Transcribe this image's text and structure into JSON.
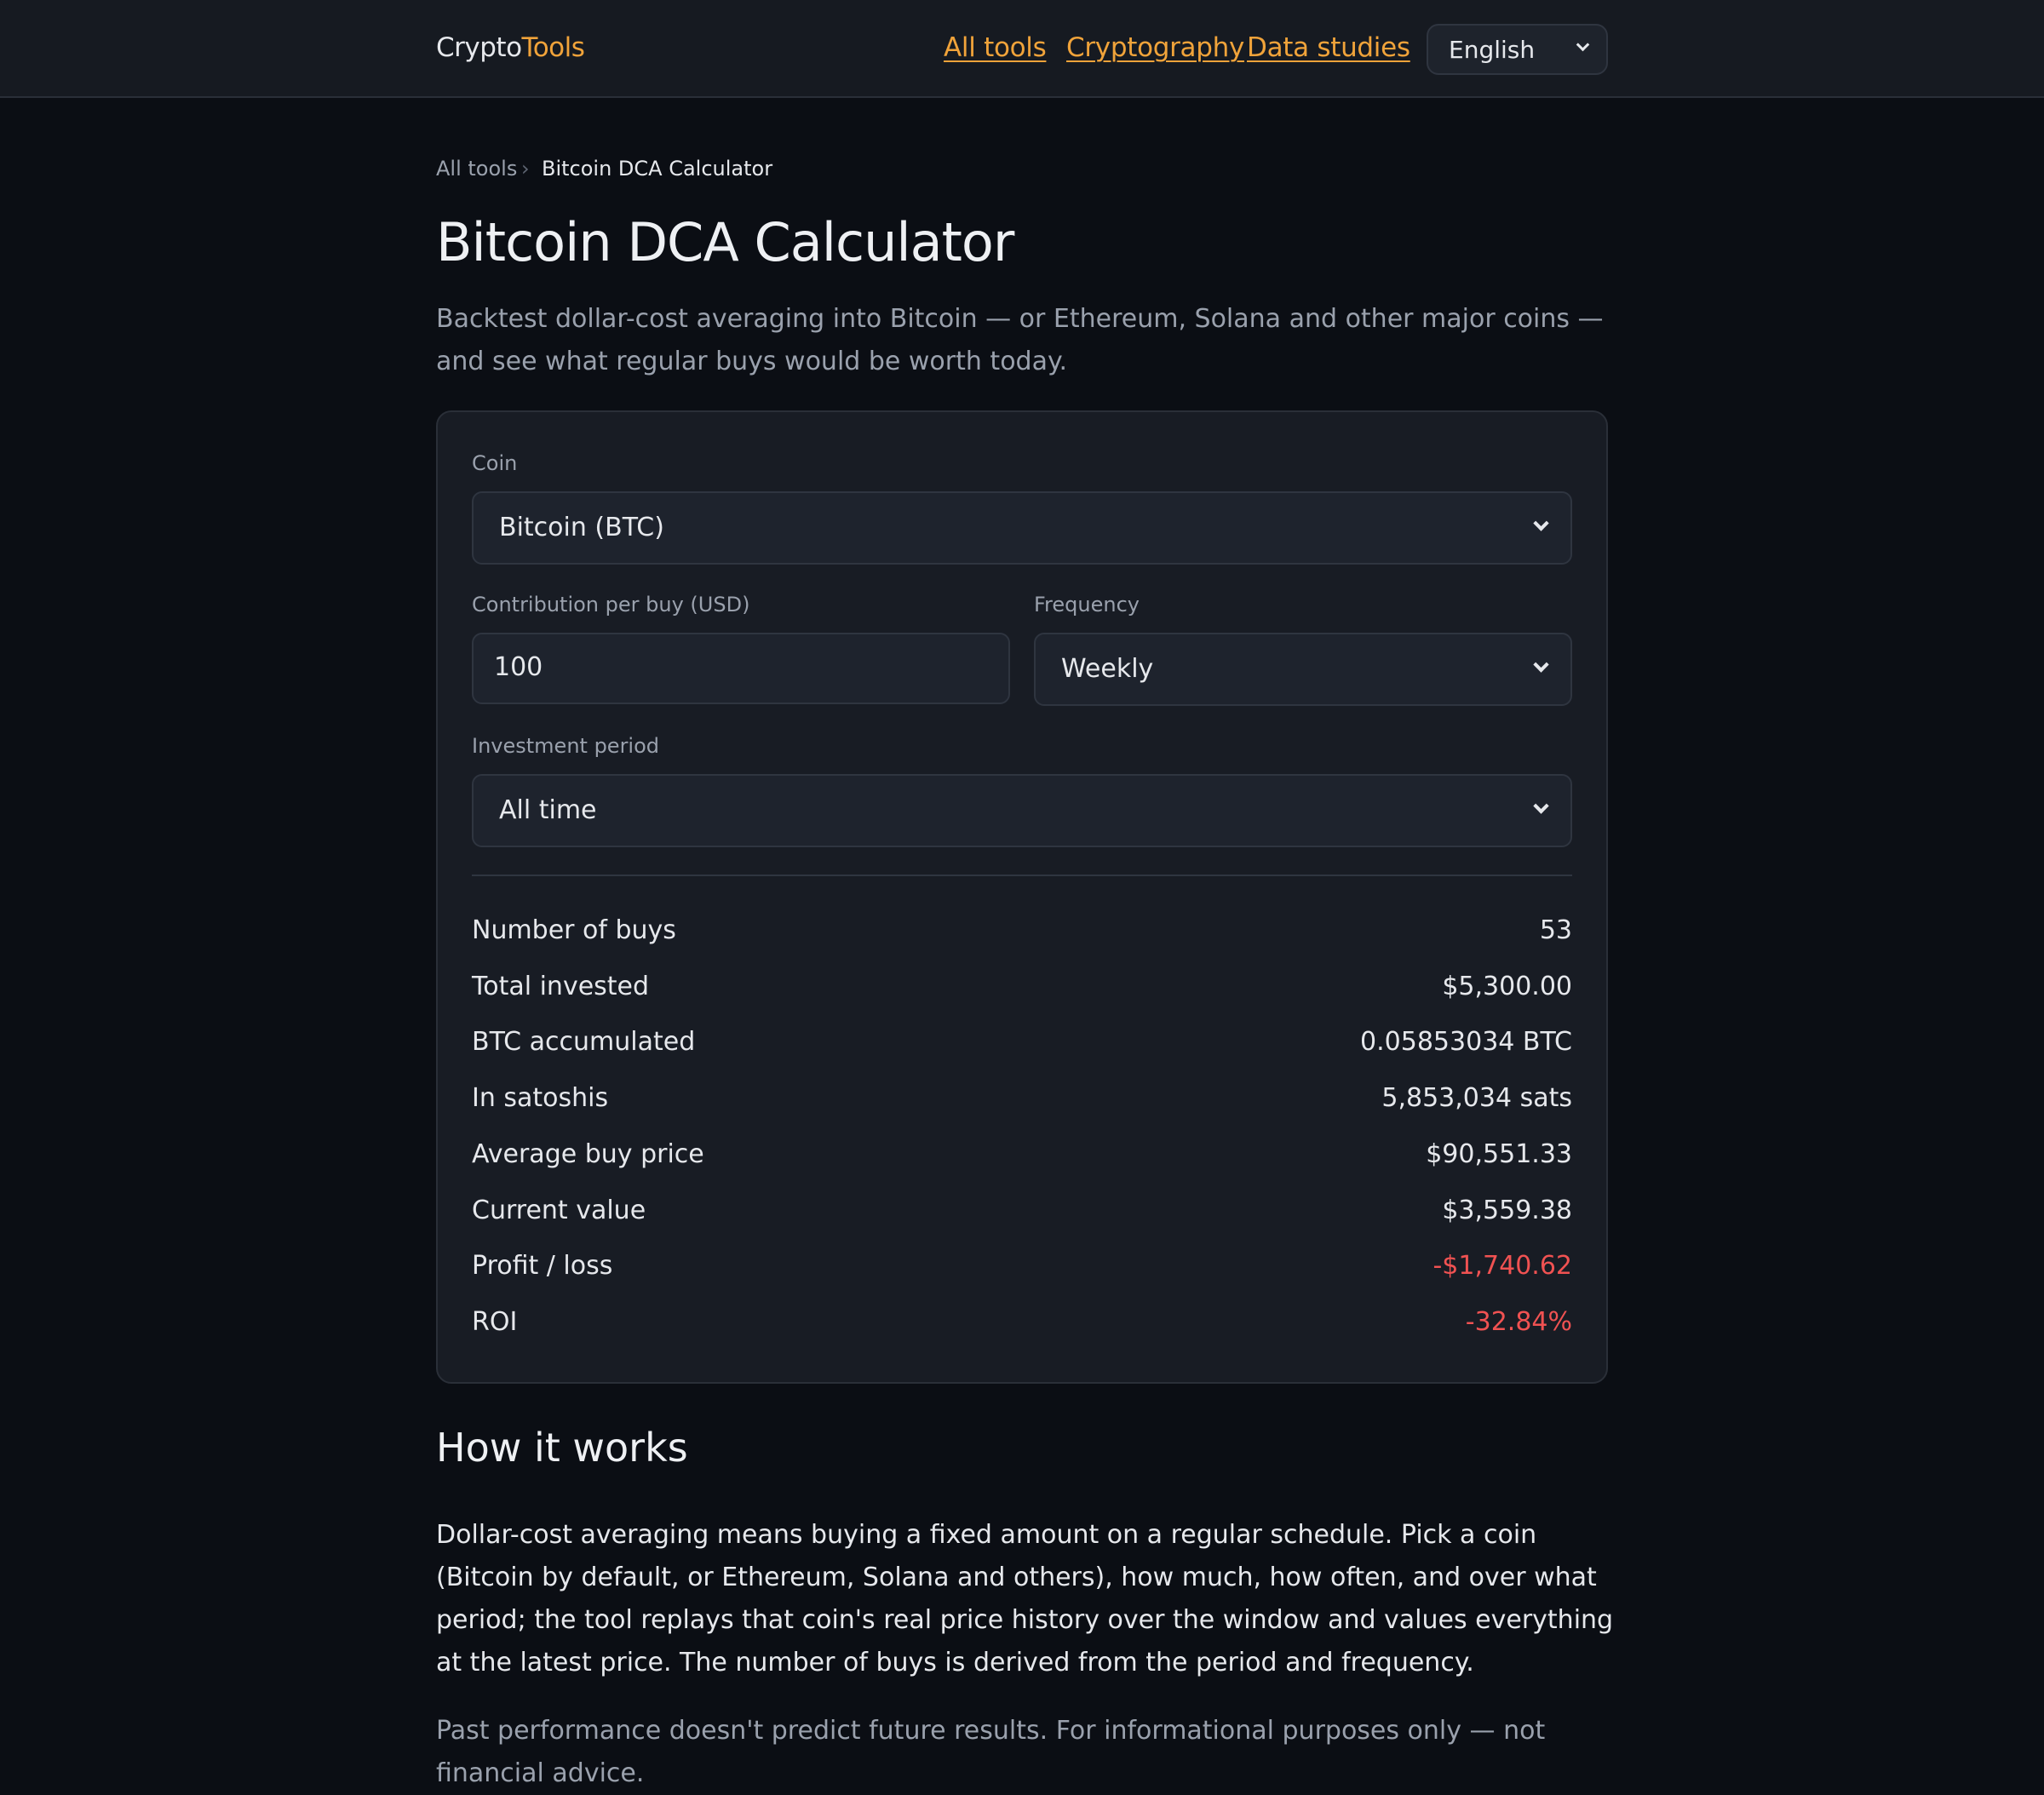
{
  "header": {
    "brand_part1": "Crypto",
    "brand_part2": "Tools",
    "nav": [
      "All tools",
      "Cryptography",
      "Data studies"
    ],
    "language": "English"
  },
  "breadcrumb": {
    "root": "All tools",
    "separator": "›",
    "current": "Bitcoin DCA Calculator"
  },
  "page": {
    "title": "Bitcoin DCA Calculator",
    "lead": "Backtest dollar-cost averaging into Bitcoin — or Ethereum, Solana and other major coins — and see what regular buys would be worth today."
  },
  "form": {
    "coin_label": "Coin",
    "coin_value": "Bitcoin (BTC)",
    "contribution_label": "Contribution per buy (USD)",
    "contribution_value": "100",
    "frequency_label": "Frequency",
    "frequency_value": "Weekly",
    "period_label": "Investment period",
    "period_value": "All time"
  },
  "results": [
    {
      "label": "Number of buys",
      "value": "53",
      "negative": false
    },
    {
      "label": "Total invested",
      "value": "$5,300.00",
      "negative": false
    },
    {
      "label": "BTC accumulated",
      "value": "0.05853034 BTC",
      "negative": false
    },
    {
      "label": "In satoshis",
      "value": "5,853,034 sats",
      "negative": false
    },
    {
      "label": "Average buy price",
      "value": "$90,551.33",
      "negative": false
    },
    {
      "label": "Current value",
      "value": "$3,559.38",
      "negative": false
    },
    {
      "label": "Profit / loss",
      "value": "-$1,740.62",
      "negative": true
    },
    {
      "label": "ROI",
      "value": "-32.84%",
      "negative": true
    }
  ],
  "how_it_works": {
    "heading": "How it works",
    "body": "Dollar-cost averaging means buying a fixed amount on a regular schedule. Pick a coin (Bitcoin by default, or Ethereum, Solana and others), how much, how often, and over what period; the tool replays that coin's real price history over the window and values everything at the latest price. The number of buys is derived from the period and frequency.",
    "disclaimer": "Past performance doesn't predict future results. For informational purposes only — not financial advice."
  },
  "colors": {
    "accent": "#f0a33a",
    "negative": "#f05252",
    "background": "#0b0e14",
    "card": "#181c24"
  }
}
